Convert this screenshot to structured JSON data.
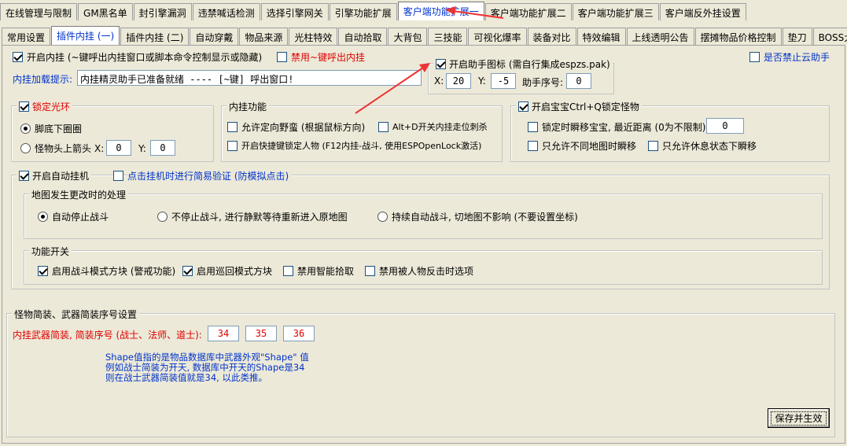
{
  "top_tabs": [
    "在线管理与限制",
    "GM黑名单",
    "封引擎漏洞",
    "违禁喊话检测",
    "选择引擎网关",
    "引擎功能扩展",
    "客户端功能扩展一",
    "客户端功能扩展二",
    "客户端功能扩展三",
    "客户端反外挂设置"
  ],
  "sub_tabs": [
    "常用设置",
    "插件内挂 (一)",
    "插件内挂 (二)",
    "自动穿戴",
    "物品来源",
    "光柱特效",
    "自动拾取",
    "大背包",
    "三技能",
    "可视化爆率",
    "装备对比",
    "特效编辑",
    "上线透明公告",
    "摆摊物品价格控制",
    "垫刀",
    "BOSS大血条"
  ],
  "top": {
    "enable_plugin": "开启内挂 (~键呼出内挂窗口或脚本命令控制显示或隐藏)",
    "disable_tilde": "禁用~键呼出内挂",
    "disable_cloud": "是否禁止云助手",
    "prompt_label": "内挂加载提示:",
    "prompt_value": "内挂精灵助手已准备就绪 ---- [~键] 呼出窗口!"
  },
  "helper_icon": {
    "title": "开启助手图标 (需自行集成espzs.pak)",
    "x_label": "X:",
    "x_value": "20",
    "y_label": "Y:",
    "y_value": "-5",
    "index_label": "助手序号:",
    "index_value": "0"
  },
  "lock_ring": {
    "title": "锁定光环",
    "option1": "脚底下圈圈",
    "option2": "怪物头上箭头",
    "x_label": "X:",
    "x_value": "0",
    "y_label": "Y:",
    "y_value": "0"
  },
  "plugin_funcs": {
    "title": "内挂功能",
    "item1": "允许定向野蛮 (根据鼠标方向)",
    "item2": "Alt+D开关内挂走位刺杀",
    "item3": "开启快捷键锁定人物 (F12内挂-战斗, 使用ESPOpenLock激活)"
  },
  "pet": {
    "title": "开启宝宝Ctrl+Q锁定怪物",
    "item1": "锁定时瞬移宝宝, 最近距离 (0为不限制):",
    "item1_value": "0",
    "item2": "只允许不同地图时瞬移",
    "item3": "只允许休息状态下瞬移"
  },
  "auto_hang": {
    "title": "开启自动挂机",
    "verify": "点击挂机时进行简易验证 (防模拟点击)",
    "map_group": "地图发生更改时的处理",
    "map_opt1": "自动停止战斗",
    "map_opt2": "不停止战斗, 进行静默等待重新进入原地图",
    "map_opt3": "持续自动战斗, 切地图不影响 (不要设置坐标)",
    "func_group": "功能开关",
    "func1": "启用战斗模式方块 (警戒功能)",
    "func2": "启用巡回模式方块",
    "func3": "禁用智能拾取",
    "func4": "禁用被人物反击时选项"
  },
  "weapon": {
    "title": "怪物简装、武器简装序号设置",
    "label": "内挂武器简装, 简装序号 (战士、法师、道士):",
    "v1": "34",
    "v2": "35",
    "v3": "36",
    "note": "Shape值指的是物品数据库中武器外观\"Shape\" 值\n例如战士简装为开天, 数据库中开天的Shape是34\n则在战士武器简装值就是34, 以此类推。"
  },
  "save_button": "保存并生效"
}
